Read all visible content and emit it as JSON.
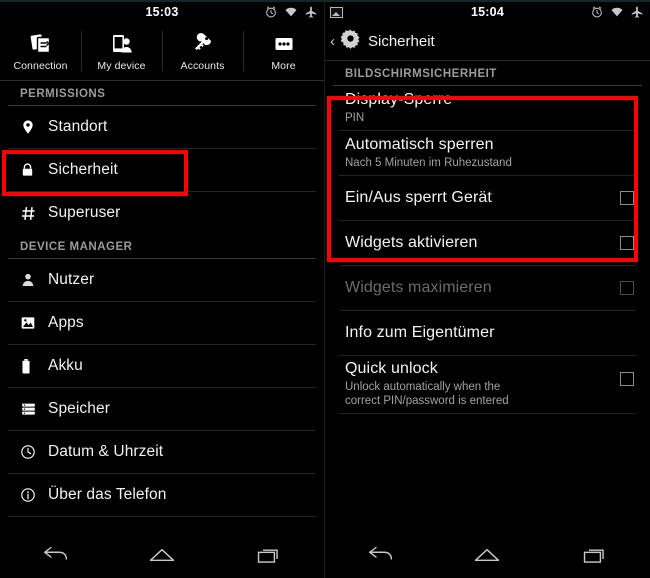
{
  "left": {
    "statusbar": {
      "clock": "15:03",
      "icons": [
        "alarm-icon",
        "wifi-icon",
        "airplane-mode-icon"
      ]
    },
    "tabs": [
      {
        "label": "Connection",
        "icon": "connection-icon"
      },
      {
        "label": "My device",
        "icon": "my-device-icon"
      },
      {
        "label": "Accounts",
        "icon": "accounts-key-icon"
      },
      {
        "label": "More",
        "icon": "more-dots-icon"
      }
    ],
    "sections": [
      {
        "title": "PERMISSIONS",
        "items": [
          {
            "label": "Standort",
            "icon": "location-pin-icon",
            "highlighted": false
          },
          {
            "label": "Sicherheit",
            "icon": "lock-icon",
            "highlighted": true
          },
          {
            "label": "Superuser",
            "icon": "hash-icon",
            "highlighted": false
          }
        ]
      },
      {
        "title": "DEVICE MANAGER",
        "items": [
          {
            "label": "Nutzer",
            "icon": "person-icon",
            "highlighted": false
          },
          {
            "label": "Apps",
            "icon": "apps-image-icon",
            "highlighted": false
          },
          {
            "label": "Akku",
            "icon": "battery-icon",
            "highlighted": false
          },
          {
            "label": "Speicher",
            "icon": "storage-icon",
            "highlighted": false
          },
          {
            "label": "Datum & Uhrzeit",
            "icon": "clock-icon",
            "highlighted": false
          },
          {
            "label": "Über das Telefon",
            "icon": "info-icon",
            "highlighted": false
          }
        ]
      }
    ],
    "navbar": [
      "back-icon",
      "home-icon",
      "recents-icon"
    ]
  },
  "right": {
    "statusbar": {
      "clock": "15:04",
      "left_icon": "picture-icon",
      "icons": [
        "alarm-icon",
        "wifi-icon",
        "airplane-mode-icon"
      ]
    },
    "actionbar": {
      "back_caret": "‹",
      "icon": "settings-gear-icon",
      "title": "Sicherheit"
    },
    "section_title": "BILDSCHIRMSICHERHEIT",
    "items": [
      {
        "title": "Display-Sperre",
        "subtitle": "PIN",
        "checkbox": false,
        "checked": false,
        "dim": false
      },
      {
        "title": "Automatisch sperren",
        "subtitle": "Nach 5 Minuten im Ruhezustand",
        "checkbox": false,
        "checked": false,
        "dim": false
      },
      {
        "title": "Ein/Aus sperrt Gerät",
        "subtitle": "",
        "checkbox": true,
        "checked": false,
        "dim": false
      },
      {
        "title": "Widgets aktivieren",
        "subtitle": "",
        "checkbox": true,
        "checked": false,
        "dim": false
      },
      {
        "title": "Widgets maximieren",
        "subtitle": "",
        "checkbox": true,
        "checked": false,
        "dim": true
      },
      {
        "title": "Info zum Eigentümer",
        "subtitle": "",
        "checkbox": false,
        "checked": false,
        "dim": false
      },
      {
        "title": "Quick unlock",
        "subtitle": "Unlock automatically when the\ncorrect PIN/password is entered",
        "checkbox": true,
        "checked": false,
        "dim": false
      }
    ],
    "navbar": [
      "back-icon",
      "home-icon",
      "recents-icon"
    ],
    "highlight_color": "#fe0000"
  }
}
